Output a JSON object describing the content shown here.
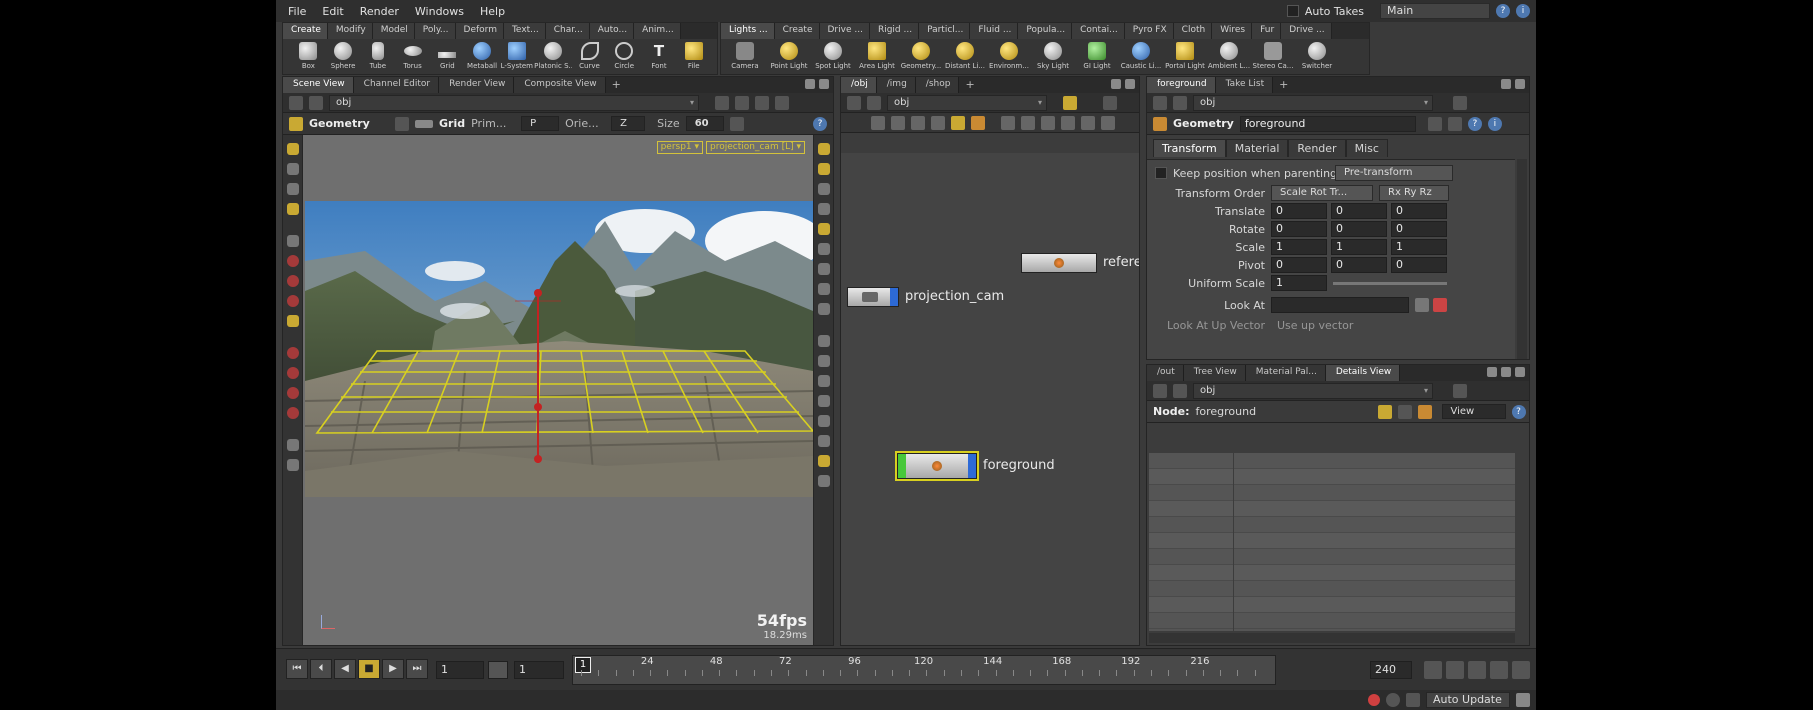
{
  "menubar": {
    "items": [
      "File",
      "Edit",
      "Render",
      "Windows",
      "Help"
    ],
    "auto_takes_label": "Auto Takes",
    "desktop": "Main"
  },
  "shelf_left": {
    "tabs": [
      "Create",
      "Modify",
      "Model",
      "Poly...",
      "Deform",
      "Text...",
      "Char...",
      "Auto...",
      "Anim..."
    ],
    "tools": [
      "Box",
      "Sphere",
      "Tube",
      "Torus",
      "Grid",
      "Metaball",
      "L-System",
      "Platonic S...",
      "Curve",
      "Circle",
      "Font",
      "File"
    ]
  },
  "shelf_right": {
    "tabs": [
      "Lights ...",
      "Create",
      "Drive ...",
      "Rigid ...",
      "Particl...",
      "Fluid ...",
      "Popula...",
      "Contai...",
      "Pyro FX",
      "Cloth",
      "Wires",
      "Fur",
      "Drive ..."
    ],
    "tools": [
      "Camera",
      "Point Light",
      "Spot Light",
      "Area Light",
      "Geometry...",
      "Distant Li...",
      "Environm...",
      "Sky Light",
      "GI Light",
      "Caustic Li...",
      "Portal Light",
      "Ambient L...",
      "Stereo Ca...",
      "Switcher"
    ]
  },
  "scene_view": {
    "tabs": [
      "Scene View",
      "Channel Editor",
      "Render View",
      "Composite View"
    ],
    "path": "obj",
    "toolbar": {
      "context": "Geometry",
      "grid_label": "Grid",
      "prim_label": "Prim...",
      "prim_value": "P",
      "orient_label": "Orie...",
      "orient_value": "Z",
      "size_label": "Size",
      "size_value": "60"
    },
    "camera_menu": "persp1 ▾",
    "camera_name": "projection_cam [L] ▾",
    "fps": "54fps",
    "frame_time": "18.29ms"
  },
  "network_view": {
    "tabs": [
      "/obj",
      "/img",
      "/shop"
    ],
    "path": "obj",
    "nodes": {
      "reference": "reference",
      "projection_cam": "projection_cam",
      "foreground": "foreground"
    }
  },
  "parameters": {
    "tabs": [
      "foreground",
      "Take List"
    ],
    "path": "obj",
    "node_type": "Geometry",
    "node_name": "foreground",
    "param_tabs": [
      "Transform",
      "Material",
      "Render",
      "Misc"
    ],
    "keep_position_label": "Keep position when parenting",
    "keep_position_value": "Pre-transform",
    "transform_order_label": "Transform Order",
    "transform_order_value": "Scale Rot Tr...",
    "rotate_order_value": "Rx Ry Rz",
    "translate_label": "Translate",
    "translate": [
      "0",
      "0",
      "0"
    ],
    "rotate_label": "Rotate",
    "rotate": [
      "0",
      "0",
      "0"
    ],
    "scale_label": "Scale",
    "scale": [
      "1",
      "1",
      "1"
    ],
    "pivot_label": "Pivot",
    "pivot": [
      "0",
      "0",
      "0"
    ],
    "uniform_scale_label": "Uniform Scale",
    "uniform_scale": "1",
    "look_at_label": "Look At",
    "look_at_up_label": "Look At Up Vector",
    "look_at_up_value": "Use up vector"
  },
  "details_view": {
    "tabs": [
      "/out",
      "Tree View",
      "Material Pal...",
      "Details View"
    ],
    "path": "obj",
    "node_label": "Node:",
    "node_value": "foreground",
    "view_menu": "View"
  },
  "timeline": {
    "current_frame": "1",
    "start_frame": "1",
    "range_start": "1",
    "end_frame": "240",
    "ticks": [
      "24",
      "48",
      "72",
      "96",
      "120",
      "144",
      "168",
      "192",
      "216"
    ]
  },
  "statusbar": {
    "auto_update": "Auto Update"
  },
  "colors": {
    "accent": "#c9a933",
    "guide_yellow": "#d8d020",
    "node_blue": "#2d6ad6",
    "node_green": "#48c83a"
  }
}
